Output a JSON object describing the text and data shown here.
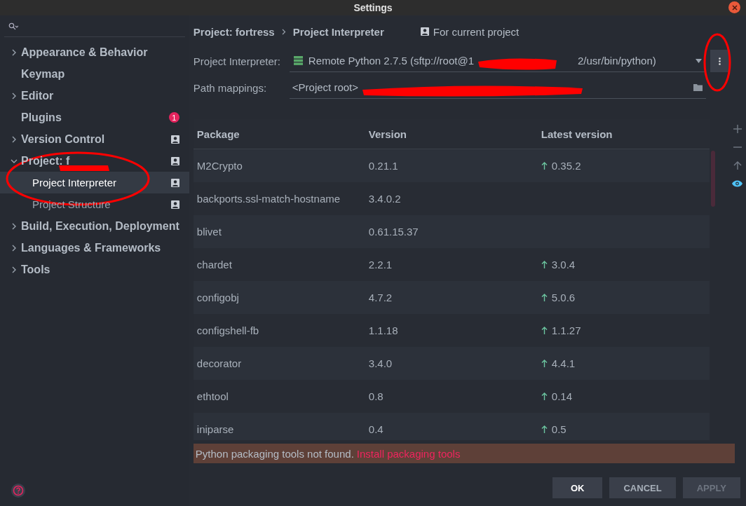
{
  "window": {
    "title": "Settings"
  },
  "sidebar": {
    "items": [
      {
        "label": "Appearance & Behavior",
        "kind": "group",
        "expanded": false,
        "selected": false
      },
      {
        "label": "Keymap",
        "kind": "page",
        "selected": false
      },
      {
        "label": "Editor",
        "kind": "group",
        "expanded": false,
        "selected": false
      },
      {
        "label": "Plugins",
        "kind": "page",
        "badge": "1",
        "selected": false
      },
      {
        "label": "Version Control",
        "kind": "group",
        "expanded": false,
        "project_scope": true,
        "selected": false
      },
      {
        "label": "Project: f",
        "kind": "group",
        "expanded": true,
        "project_scope": true,
        "selected": false,
        "children": [
          {
            "label": "Project Interpreter",
            "kind": "page",
            "project_scope": true,
            "selected": true
          },
          {
            "label": "Project Structure",
            "kind": "page",
            "project_scope": true,
            "selected": false
          }
        ]
      },
      {
        "label": "Build, Execution, Deployment",
        "kind": "group",
        "expanded": false,
        "selected": false
      },
      {
        "label": "Languages & Frameworks",
        "kind": "group",
        "expanded": false,
        "selected": false
      },
      {
        "label": "Tools",
        "kind": "group",
        "expanded": false,
        "selected": false
      }
    ]
  },
  "breadcrumb": [
    "Project: fortress",
    "Project Interpreter"
  ],
  "scope_note": "For current project",
  "interpreter": {
    "label": "Project Interpreter:",
    "value_start": "Remote Python 2.7.5 (sftp://root@1",
    "value_end": "2/usr/bin/python)"
  },
  "path_mappings": {
    "label": "Path mappings:",
    "value": "<Project root>"
  },
  "table": {
    "columns": [
      "Package",
      "Version",
      "Latest version"
    ],
    "rows": [
      {
        "package": "M2Crypto",
        "version": "0.21.1",
        "latest": "0.35.2"
      },
      {
        "package": "backports.ssl-match-hostname",
        "version": "3.4.0.2"
      },
      {
        "package": "blivet",
        "version": "0.61.15.37"
      },
      {
        "package": "chardet",
        "version": "2.2.1",
        "latest": "3.0.4"
      },
      {
        "package": "configobj",
        "version": "4.7.2",
        "latest": "5.0.6"
      },
      {
        "package": "configshell-fb",
        "version": "1.1.18",
        "latest": "1.1.27"
      },
      {
        "package": "decorator",
        "version": "3.4.0",
        "latest": "4.4.1"
      },
      {
        "package": "ethtool",
        "version": "0.8",
        "latest": "0.14"
      },
      {
        "package": "iniparse",
        "version": "0.4",
        "latest": "0.5"
      }
    ]
  },
  "package_tools": {
    "show_latest_on": true
  },
  "warning": {
    "text": "Python packaging tools not found.",
    "link": "Install packaging tools"
  },
  "buttons": [
    {
      "label": "OK",
      "kind": "primary"
    },
    {
      "label": "CANCEL",
      "kind": "normal"
    },
    {
      "label": "APPLY",
      "kind": "disabled"
    }
  ]
}
